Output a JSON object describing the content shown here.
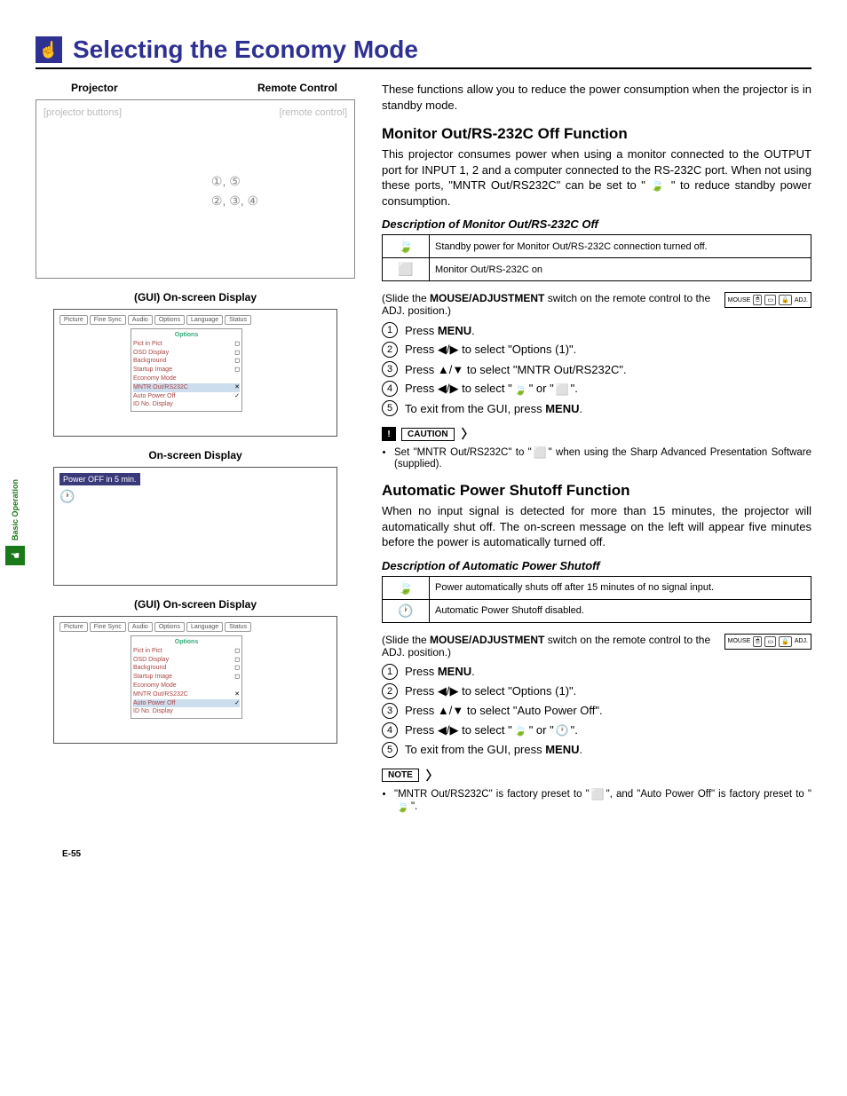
{
  "sideTab": "Basic Operation",
  "pageNumber": "E-55",
  "title": "Selecting the Economy Mode",
  "left": {
    "projectorLabel": "Projector",
    "remoteLabel": "Remote Control",
    "callout1": "①, ⑤",
    "callout2": "②, ③, ④",
    "guiLabel1": "(GUI) On-screen Display",
    "osdTabs": [
      "Picture",
      "Fine Sync",
      "Audio",
      "Options",
      "Language",
      "Status"
    ],
    "osdMenuTitle": "Options",
    "osdItems1": [
      {
        "name": "Pict in Pict",
        "val": "◻"
      },
      {
        "name": "OSD Display",
        "val": "◻"
      },
      {
        "name": "Background",
        "val": "◻"
      },
      {
        "name": "Startup Image",
        "val": "◻"
      },
      {
        "name": "Economy Mode",
        "val": ""
      },
      {
        "name": "MNTR Out/RS232C",
        "val": "✕",
        "hl": true
      },
      {
        "name": "Auto Power Off",
        "val": "✓"
      },
      {
        "name": "ID No. Display",
        "val": ""
      }
    ],
    "onscreenLabel": "On-screen Display",
    "poweroffMsg": "Power OFF in 5 min.",
    "guiLabel2": "(GUI) On-screen Display",
    "osdItems2": [
      {
        "name": "Pict in Pict",
        "val": "◻"
      },
      {
        "name": "OSD Display",
        "val": "◻"
      },
      {
        "name": "Background",
        "val": "◻"
      },
      {
        "name": "Startup Image",
        "val": "◻"
      },
      {
        "name": "Economy Mode",
        "val": ""
      },
      {
        "name": "MNTR Out/RS232C",
        "val": "✕"
      },
      {
        "name": "Auto Power Off",
        "val": "✓",
        "hl": true
      },
      {
        "name": "ID No. Display",
        "val": ""
      }
    ]
  },
  "right": {
    "intro": "These functions allow you to reduce the power consumption when the projector is in standby mode.",
    "section1": {
      "heading": "Monitor Out/RS-232C Off Function",
      "body": "This projector consumes power when using a monitor connected to the OUTPUT port for INPUT 1, 2 and a computer connected to the RS-232C port. When not using these ports, \"MNTR Out/RS232C\" can be set to \" 🍃 \" to reduce standby power consumption.",
      "descHeading": "Description of Monitor Out/RS-232C Off",
      "table": [
        {
          "icon": "leaf",
          "text": "Standby power for Monitor Out/RS-232C connection turned off."
        },
        {
          "icon": "monitor",
          "text": "Monitor Out/RS-232C on"
        }
      ],
      "slideText": "(Slide the MOUSE/ADJUSTMENT switch on the remote control to the ADJ. position.)",
      "adjLabels": [
        "MOUSE",
        "ADJ."
      ],
      "steps": [
        {
          "n": "1",
          "text": "Press MENU."
        },
        {
          "n": "2",
          "text": "Press ◀/▶ to select \"Options (1)\"."
        },
        {
          "n": "3",
          "text": "Press ▲/▼ to select \"MNTR Out/RS232C\"."
        },
        {
          "n": "4",
          "text": "Press ◀/▶ to select \" 🍃 \" or \" ⬜ \"."
        },
        {
          "n": "5",
          "text": "To exit from the GUI, press MENU."
        }
      ],
      "cautionLabel": "CAUTION",
      "cautionText": "Set \"MNTR Out/RS232C\" to \" ⬜ \" when using the Sharp Advanced Presentation Software (supplied)."
    },
    "section2": {
      "heading": "Automatic Power Shutoff Function",
      "body": "When no input signal is detected for more than 15 minutes, the projector will automatically shut off. The on-screen message on the left will appear five minutes before the power is automatically turned off.",
      "descHeading": "Description of Automatic Power Shutoff",
      "table": [
        {
          "icon": "leaf",
          "text": "Power automatically shuts off after 15 minutes of no signal input."
        },
        {
          "icon": "clock",
          "text": "Automatic Power Shutoff disabled."
        }
      ],
      "slideText": "(Slide the MOUSE/ADJUSTMENT switch on the remote control to the ADJ. position.)",
      "adjLabels": [
        "MOUSE",
        "ADJ."
      ],
      "steps": [
        {
          "n": "1",
          "text": "Press MENU."
        },
        {
          "n": "2",
          "text": "Press ◀/▶ to select \"Options (1)\"."
        },
        {
          "n": "3",
          "text": "Press ▲/▼ to select \"Auto Power Off\"."
        },
        {
          "n": "4",
          "text": "Press ◀/▶ to select \" 🍃 \" or \" 🕐 \"."
        },
        {
          "n": "5",
          "text": "To exit from the GUI, press MENU."
        }
      ],
      "noteLabel": "NOTE",
      "noteText": "\"MNTR Out/RS232C\" is factory preset to \" ⬜ \", and \"Auto Power Off\" is factory preset to \" 🍃 \"."
    }
  }
}
